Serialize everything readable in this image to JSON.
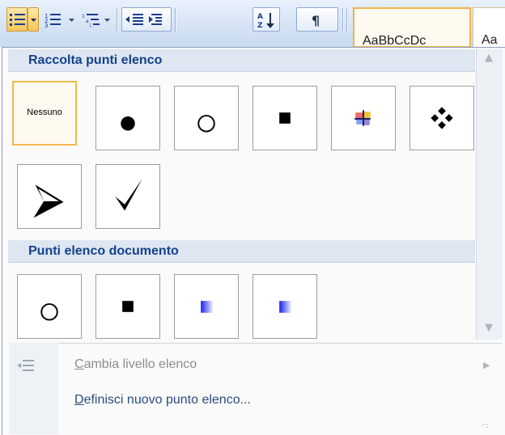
{
  "ribbon": {
    "style_preview_1": "AaBbCcDc",
    "style_preview_2": "Aa",
    "icons": [
      "bullets-icon",
      "bullets-dropdown-arrow",
      "numbering-icon",
      "numbering-dropdown-arrow",
      "multilevel-list-icon",
      "multilevel-dropdown-arrow",
      "decrease-indent-icon",
      "increase-indent-icon",
      "sort-icon",
      "show-formatting-marks-icon"
    ]
  },
  "library": {
    "header": "Raccolta punti elenco",
    "items": [
      {
        "label": "Nessuno",
        "glyph": "none",
        "selected": true
      },
      {
        "glyph": "filled-circle"
      },
      {
        "glyph": "hollow-circle"
      },
      {
        "glyph": "filled-square"
      },
      {
        "glyph": "colored-cross"
      },
      {
        "glyph": "four-diamonds"
      },
      {
        "glyph": "arrowhead"
      },
      {
        "glyph": "checkmark"
      }
    ]
  },
  "document": {
    "header": "Punti elenco documento",
    "items": [
      {
        "glyph": "hollow-circle"
      },
      {
        "glyph": "filled-square"
      },
      {
        "glyph": "blue-gradient-square"
      },
      {
        "glyph": "blue-gradient-square"
      }
    ]
  },
  "menu": {
    "change_level": {
      "label_first": "C",
      "label_rest": "ambia livello elenco",
      "enabled": false
    },
    "define_new": {
      "label_first": "D",
      "label_rest": "efinisci nuovo punto elenco...",
      "enabled": true
    }
  },
  "colors": {
    "header_text": "#15428b",
    "header_bg": "#dde6f1",
    "selected_border": "#f2b94b",
    "blue_square_start": "#1a22e6",
    "blue_square_end": "#e8ecff"
  }
}
